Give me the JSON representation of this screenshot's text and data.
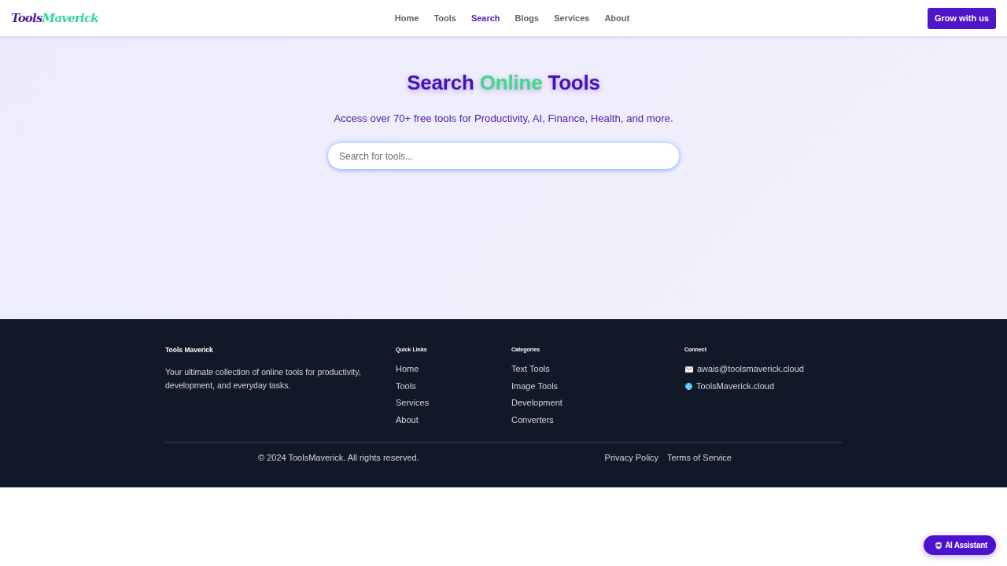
{
  "header": {
    "logo": [
      {
        "text": "Tools",
        "highlighted": false
      },
      {
        "text": "Maverick",
        "highlighted": true
      }
    ],
    "nav": [
      {
        "label": "Home",
        "selected": false
      },
      {
        "label": "Tools",
        "selected": false
      },
      {
        "label": "Search",
        "selected": true
      },
      {
        "label": "Blogs",
        "selected": false
      },
      {
        "label": "Services",
        "selected": false
      },
      {
        "label": "About",
        "selected": false
      }
    ],
    "cta": "Grow with us"
  },
  "hero": {
    "title": [
      {
        "text": "Search",
        "highlighted": false
      },
      {
        "text": "Online",
        "highlighted": true
      },
      {
        "text": "Tools",
        "highlighted": false
      }
    ],
    "subtitle": "Access over 70+ free tools for Productivity, AI, Finance, Health, and more.",
    "search": {
      "placeholder": "Search for tools..."
    }
  },
  "footer": {
    "brand": {
      "title": "Tools Maverick",
      "description": "Your ultimate collection of online tools for productivity, development, and everyday tasks."
    },
    "columns": [
      {
        "heading": "Quick Links",
        "items": [
          {
            "label": "Home",
            "kind": "link"
          },
          {
            "label": "Tools",
            "kind": "link"
          },
          {
            "label": "Services",
            "kind": "link"
          },
          {
            "label": "About",
            "kind": "link"
          }
        ]
      },
      {
        "heading": "Categories",
        "items": [
          {
            "label": "Text Tools",
            "kind": "link"
          },
          {
            "label": "Image Tools",
            "kind": "link"
          },
          {
            "label": "Development",
            "kind": "link"
          },
          {
            "label": "Converters",
            "kind": "link"
          }
        ]
      },
      {
        "heading": "Connect",
        "items": [
          {
            "label": "awais@toolsmaverick.cloud",
            "kind": "email"
          },
          {
            "label": "ToolsMaverick.cloud",
            "kind": "website"
          }
        ]
      }
    ],
    "copyright": "© 2024 ToolsMaverick. All rights reserved.",
    "legal_links": [
      "Privacy Policy",
      "Terms of Service"
    ]
  },
  "assistant_button": {
    "label": "AI Assistant"
  }
}
